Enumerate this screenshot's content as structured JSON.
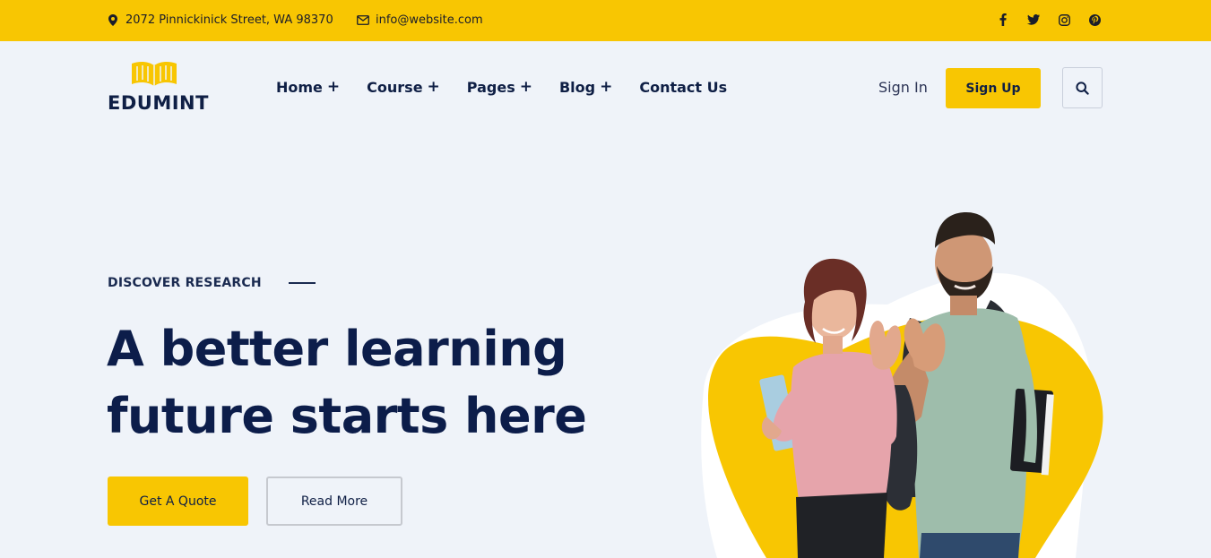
{
  "topbar": {
    "address": "2072 Pinnickinick Street, WA 98370",
    "email": "info@website.com",
    "social": [
      "facebook-icon",
      "twitter-icon",
      "instagram-icon",
      "pinterest-icon"
    ]
  },
  "header": {
    "logo_text": "EDUMINT",
    "nav": [
      {
        "label": "Home",
        "has_submenu": true
      },
      {
        "label": "Course",
        "has_submenu": true
      },
      {
        "label": "Pages",
        "has_submenu": true
      },
      {
        "label": "Blog",
        "has_submenu": true
      },
      {
        "label": "Contact Us",
        "has_submenu": false
      }
    ],
    "sign_in": "Sign In",
    "sign_up": "Sign Up",
    "plus_symbol": "+"
  },
  "hero": {
    "eyebrow": "DISCOVER RESEARCH",
    "headline_line1": "A better learning",
    "headline_line2": "future starts here",
    "primary_button": "Get A Quote",
    "secondary_button": "Read More"
  },
  "colors": {
    "accent": "#f8c602",
    "dark": "#0f1f45",
    "background": "#eff3f9"
  }
}
